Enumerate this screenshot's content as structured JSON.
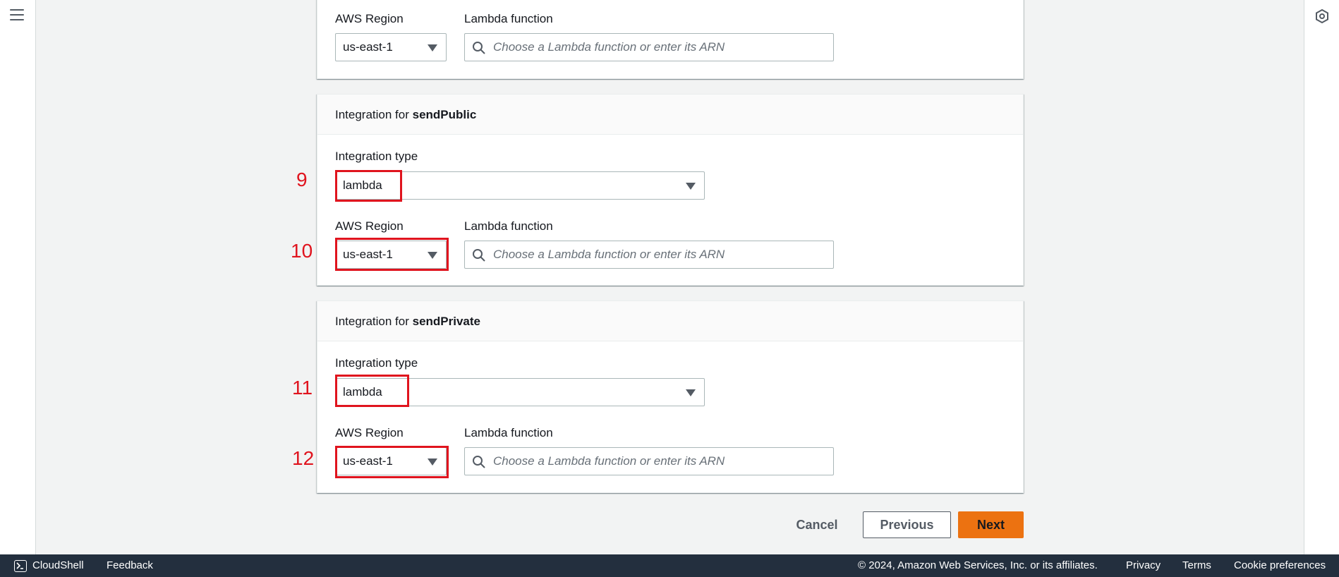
{
  "card1": {
    "aws_region_label": "AWS Region",
    "region_value": "us-east-1",
    "lambda_function_label": "Lambda function",
    "lambda_placeholder": "Choose a Lambda function or enter its ARN"
  },
  "card2": {
    "header_prefix": "Integration for ",
    "header_route": "sendPublic",
    "integration_type_label": "Integration type",
    "integration_type_value": "lambda",
    "aws_region_label": "AWS Region",
    "region_value": "us-east-1",
    "lambda_function_label": "Lambda function",
    "lambda_placeholder": "Choose a Lambda function or enter its ARN"
  },
  "card3": {
    "header_prefix": "Integration for ",
    "header_route": "sendPrivate",
    "integration_type_label": "Integration type",
    "integration_type_value": "lambda",
    "aws_region_label": "AWS Region",
    "region_value": "us-east-1",
    "lambda_function_label": "Lambda function",
    "lambda_placeholder": "Choose a Lambda function or enter its ARN"
  },
  "annotations": [
    "9",
    "10",
    "11",
    "12"
  ],
  "actions": {
    "cancel": "Cancel",
    "previous": "Previous",
    "next": "Next"
  },
  "footer": {
    "cloudshell": "CloudShell",
    "feedback": "Feedback",
    "copyright": "© 2024, Amazon Web Services, Inc. or its affiliates.",
    "privacy": "Privacy",
    "terms": "Terms",
    "cookie": "Cookie preferences"
  },
  "colors": {
    "accent_orange": "#ec7211",
    "annotation_red": "#e0141e",
    "footer_bg": "#232f3e"
  },
  "icons": [
    "hamburger-menu-icon",
    "notifications-icon",
    "search-icon",
    "caret-down-icon",
    "cloudshell-icon"
  ]
}
